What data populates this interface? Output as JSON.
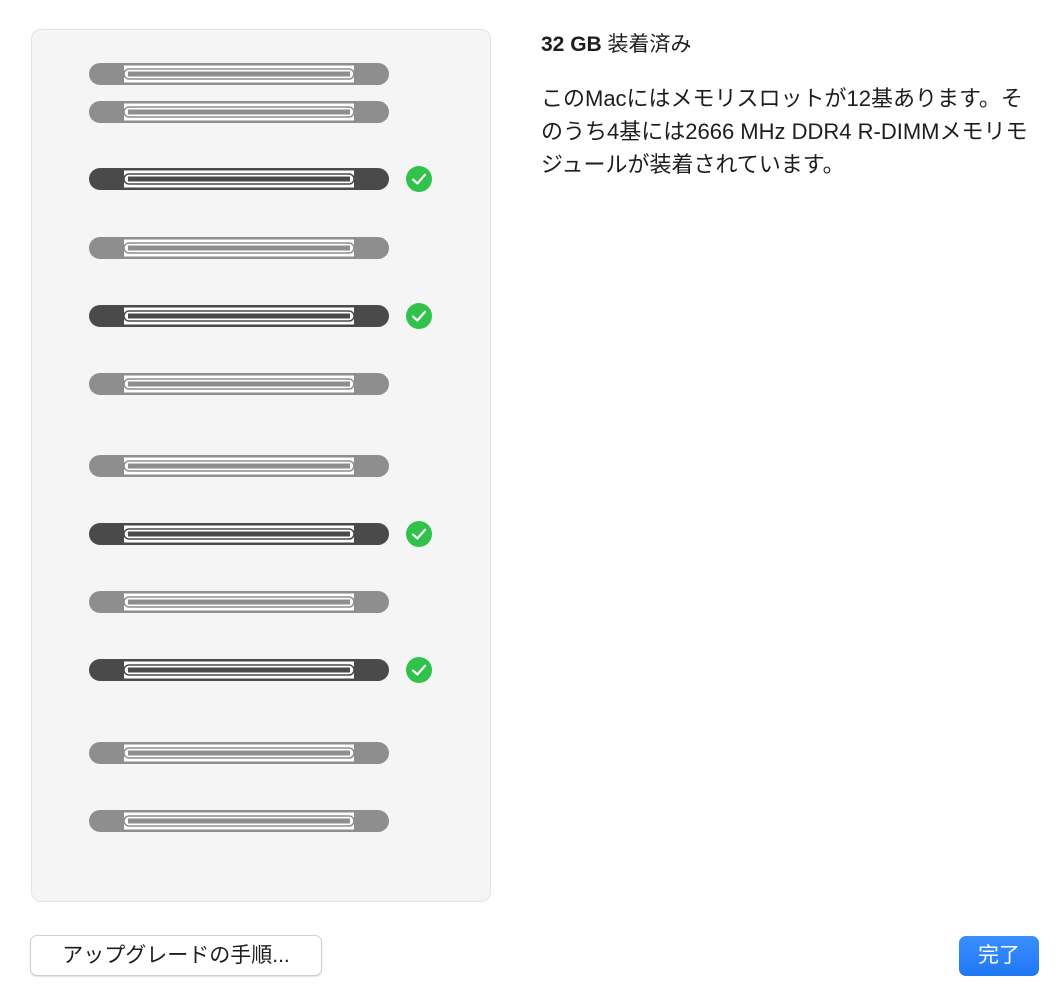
{
  "memory": {
    "capacity": "32 GB",
    "installed_label": "装着済み",
    "description": "このMacにはメモリスロットが12基あります。そのうち4基には2666 MHz DDR4 R-DIMMメモリモジュールが装着されています。"
  },
  "slots": [
    {
      "installed": false
    },
    {
      "installed": false
    },
    {
      "installed": true
    },
    {
      "installed": false
    },
    {
      "installed": true
    },
    {
      "installed": false
    },
    {
      "installed": false
    },
    {
      "installed": true
    },
    {
      "installed": false
    },
    {
      "installed": true
    },
    {
      "installed": false
    },
    {
      "installed": false
    }
  ],
  "buttons": {
    "upgrade_label": "アップグレードの手順...",
    "done_label": "完了"
  },
  "colors": {
    "installed_module": "#4a4a4a",
    "empty_slot": "#8e8e8e",
    "check": "#30c24a",
    "accent": "#2a82f8"
  }
}
